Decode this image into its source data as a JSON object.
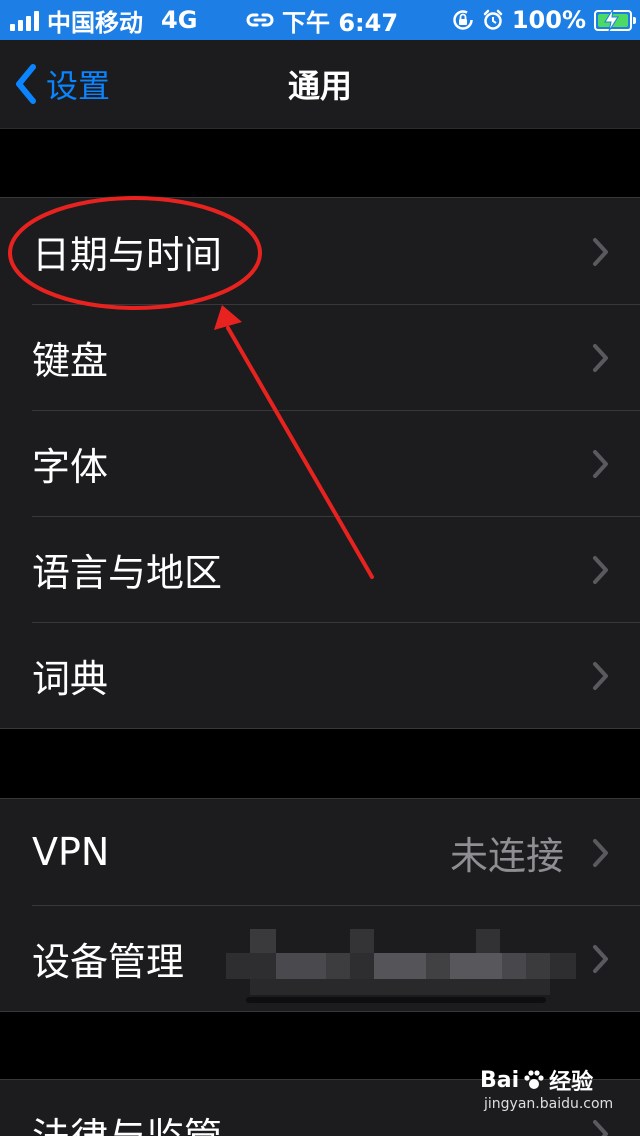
{
  "status_bar": {
    "carrier": "中国移动",
    "network": "4G",
    "time": "下午 6:47",
    "battery_percent": "100%",
    "battery_level": 1.0,
    "background_color": "#1d7fe6",
    "icons": [
      "signal-icon",
      "link-icon",
      "orientation-lock-icon",
      "alarm-icon",
      "battery-charging-icon"
    ]
  },
  "nav": {
    "back_label": "设置",
    "title": "通用",
    "accent_color": "#0a84ff"
  },
  "groups": [
    {
      "rows": [
        {
          "label": "日期与时间"
        },
        {
          "label": "键盘"
        },
        {
          "label": "字体"
        },
        {
          "label": "语言与地区"
        },
        {
          "label": "词典"
        }
      ]
    },
    {
      "rows": [
        {
          "label": "VPN",
          "value": "未连接"
        },
        {
          "label": "设备管理",
          "value_obscured": true
        }
      ]
    },
    {
      "rows": [
        {
          "label": "法律与监管"
        }
      ]
    }
  ],
  "annotation": {
    "highlight_color": "#e8231f",
    "highlighted_row": "日期与时间"
  },
  "watermark": {
    "brand": "Bai",
    "brand_suffix": "经验",
    "url": "jingyan.baidu.com"
  }
}
